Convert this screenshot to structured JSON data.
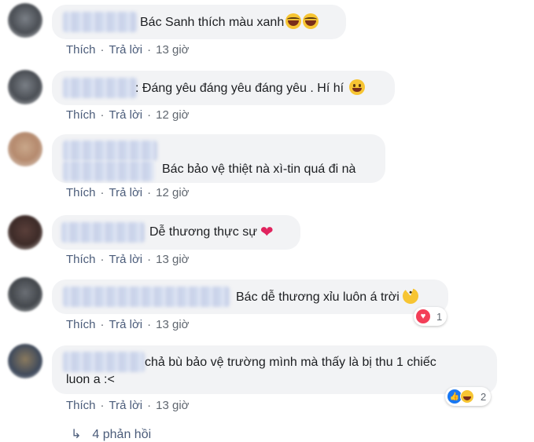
{
  "actions": {
    "like": "Thích",
    "reply": "Trả lời",
    "separator": "·"
  },
  "comments": [
    {
      "text": "Bác Sanh thích màu xanh",
      "time": "13 giờ",
      "emoji": "laugh-icon x2"
    },
    {
      "text": ": Đáng yêu đáng yêu đáng yêu . Hí hí",
      "time": "12 giờ",
      "emoji": "smile-icon"
    },
    {
      "text": "Bác bảo vệ thiệt nà xì-tin quá đi nà",
      "time": "12 giờ"
    },
    {
      "text": "Dễ thương thực sự",
      "time": "13 giờ",
      "emoji": "heart-icon"
    },
    {
      "text": "Bác dễ thương xỉu luôn á trời",
      "time": "13 giờ",
      "emoji": "pacman-icon",
      "reactions": {
        "types": [
          "love"
        ],
        "count": "1"
      }
    },
    {
      "text_line1": "chả bù bảo vệ trường mình mà thấy là bị thu 1 chiếc",
      "text_line2": "luon a :<",
      "time": "13 giờ",
      "reactions": {
        "types": [
          "like",
          "haha"
        ],
        "count": "2"
      }
    }
  ],
  "view_replies": "4 phản hồi",
  "colors": {
    "bubble": "#f2f3f5",
    "link": "#4b5c7a",
    "meta": "#606770",
    "love": "#f33e58",
    "like": "#1877f2"
  }
}
